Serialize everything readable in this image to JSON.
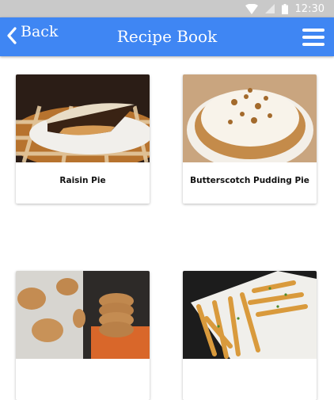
{
  "status_bar": {
    "time": "12:30",
    "icons": [
      "wifi-icon",
      "signal-icon",
      "battery-icon"
    ]
  },
  "app_bar": {
    "back_label": "Back",
    "title": "Recipe Book",
    "menu_icon": "hamburger-menu-icon",
    "color": "#3f86f3"
  },
  "recipes": [
    {
      "name": "Raisin Pie",
      "image": "raisin-pie-photo"
    },
    {
      "name": "Butterscotch Pudding Pie",
      "image": "butterscotch-pudding-pie-photo"
    },
    {
      "name": "",
      "image": "peanut-butter-cookies-photo"
    },
    {
      "name": "",
      "image": "garlic-fries-photo"
    }
  ]
}
